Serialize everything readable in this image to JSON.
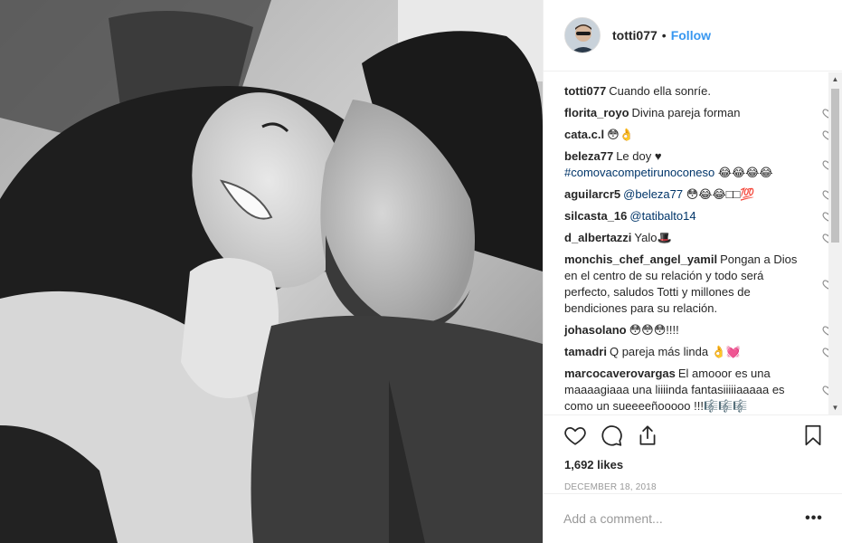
{
  "header": {
    "username": "totti077",
    "separator": "•",
    "follow_label": "Follow"
  },
  "comments": [
    {
      "user": "totti077",
      "text": "Cuando ella sonríe.",
      "tag": "",
      "text_after": "",
      "liked_icon": false
    },
    {
      "user": "florita_royo",
      "text": "Divina pareja forman",
      "tag": "",
      "text_after": "",
      "liked_icon": true
    },
    {
      "user": "cata.c.l",
      "text": "😳👌",
      "tag": "",
      "text_after": "",
      "liked_icon": true
    },
    {
      "user": "beleza77",
      "text": "Le doy ♥",
      "tag": "#comovacompetirunoconeso",
      "text_after": " 😂😂😂😂",
      "liked_icon": true
    },
    {
      "user": "aguilarcr5",
      "text": "",
      "tag": "@beleza77",
      "text_after": " 😳😂😂□□💯",
      "liked_icon": true
    },
    {
      "user": "silcasta_16",
      "text": "",
      "tag": "@tatibalto14",
      "text_after": "",
      "liked_icon": true
    },
    {
      "user": "d_albertazzi",
      "text": "Yalo🎩",
      "tag": "",
      "text_after": "",
      "liked_icon": true
    },
    {
      "user": "monchis_chef_angel_yamil",
      "text": "Pongan a Dios en el centro de su relación y todo será perfecto, saludos Totti y millones de bendiciones para su relación.",
      "tag": "",
      "text_after": "",
      "liked_icon": true
    },
    {
      "user": "johasolano",
      "text": "😳😳😳!!!!",
      "tag": "",
      "text_after": "",
      "liked_icon": true
    },
    {
      "user": "tamadri",
      "text": "Q pareja más linda 👌💓",
      "tag": "",
      "text_after": "",
      "liked_icon": true
    },
    {
      "user": "marcocaverovargas",
      "text": "El amooor es una maaaagiaaa una liiiinda fantasiiiiiaaaaa es como un sueeeeñooooo !!!🎼🎼🎼",
      "tag": "",
      "text_after": "",
      "liked_icon": true
    }
  ],
  "actions": {
    "likes": "1,692 likes",
    "date": "DECEMBER 18, 2018"
  },
  "add_comment": {
    "placeholder": "Add a comment...",
    "more": "•••"
  },
  "colors": {
    "link": "#3897f0",
    "hashtag": "#003569",
    "border": "#efefef",
    "muted": "#999999"
  },
  "icons": [
    "heart-icon",
    "comment-icon",
    "share-icon",
    "bookmark-icon",
    "more-options-icon"
  ]
}
